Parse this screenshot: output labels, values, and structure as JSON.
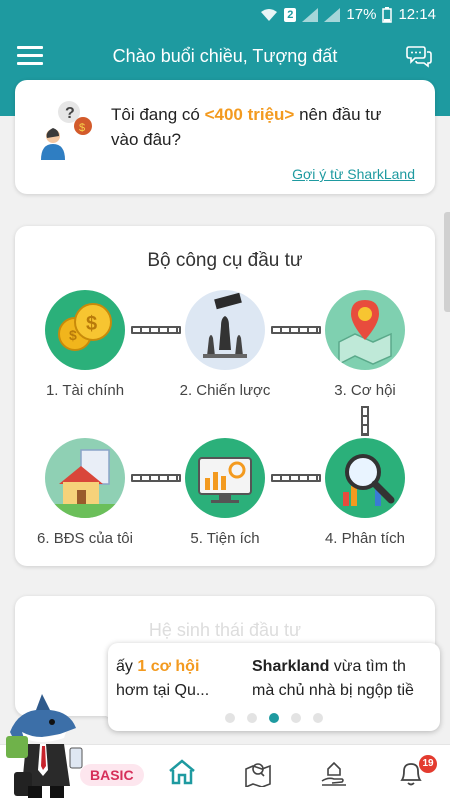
{
  "status_bar": {
    "sim_badge": "2",
    "battery": "17%",
    "time": "12:14"
  },
  "header": {
    "title": "Chào buổi chiều, Tượng đất"
  },
  "question_card": {
    "text_before": "Tôi đang có ",
    "amount": "<400 triệu>",
    "text_after": " nên đầu tư vào đâu?",
    "link": "Gợi ý từ SharkLand"
  },
  "tools": {
    "title": "Bộ công cụ đầu tư",
    "items": [
      {
        "label": "1. Tài chính",
        "icon": "coins-icon"
      },
      {
        "label": "2. Chiến lược",
        "icon": "chess-icon"
      },
      {
        "label": "3. Cơ hội",
        "icon": "map-pin-icon"
      },
      {
        "label": "4. Phân tích",
        "icon": "magnifier-chart-icon"
      },
      {
        "label": "5. Tiện ích",
        "icon": "monitor-gear-icon"
      },
      {
        "label": "6. BĐS của tôi",
        "icon": "house-icon"
      }
    ]
  },
  "ecosystem": {
    "title": "Hệ sinh thái đầu tư"
  },
  "bubble": {
    "slide1_line1_prefix": "ấy ",
    "slide1_line1_highlight": "1 cơ hội",
    "slide1_line2": "hơm tại Qu...",
    "slide2_line1_brand": "Sharkland",
    "slide2_line1_rest": " vừa tìm th",
    "slide2_line2": "mà chủ nhà bị ngộp tiề",
    "dots_total": 5,
    "active_dot": 3
  },
  "bottom_nav": {
    "badge": "BASIC",
    "items": [
      "home-icon",
      "map-search-icon",
      "hand-house-icon",
      "bell-icon"
    ],
    "notification_count": "19"
  },
  "colors": {
    "teal": "#1e9aa0",
    "orange": "#f39a1f",
    "badge_red": "#d62f5a"
  }
}
